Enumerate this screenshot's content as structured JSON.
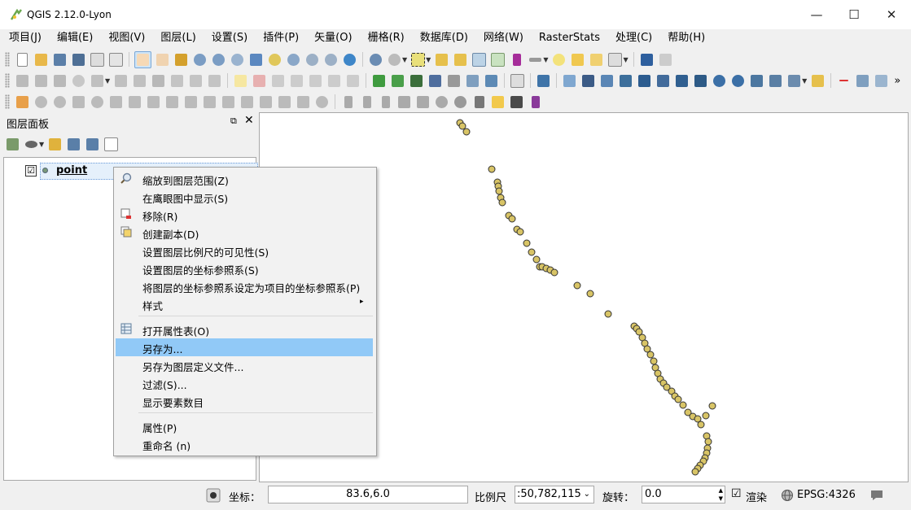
{
  "window": {
    "title": "QGIS 2.12.0-Lyon",
    "minimize": "—",
    "maximize": "☐",
    "close": "✕"
  },
  "menubar": [
    "项目(J)",
    "编辑(E)",
    "视图(V)",
    "图层(L)",
    "设置(S)",
    "插件(P)",
    "矢量(O)",
    "栅格(R)",
    "数据库(D)",
    "网络(W)",
    "RasterStats",
    "处理(C)",
    "帮助(H)"
  ],
  "toolbar_more": "»",
  "layers_panel": {
    "title": "图层面板",
    "float_icon": "⧉",
    "close_icon": "✕",
    "layer": {
      "name": "point",
      "checked": "☑"
    }
  },
  "context_menu": {
    "items": [
      {
        "label": "缩放到图层范围(Z)",
        "icon": "zoom-layer-icon"
      },
      {
        "label": "在鹰眼图中显示(S)",
        "icon": ""
      },
      {
        "label": "移除(R)",
        "icon": "remove-layer-icon"
      },
      {
        "label": "创建副本(D)",
        "icon": "duplicate-layer-icon"
      },
      {
        "label": "设置图层比例尺的可见性(S)",
        "icon": ""
      },
      {
        "label": "设置图层的坐标参照系(S)",
        "icon": ""
      },
      {
        "label": "将图层的坐标参照系设定为项目的坐标参照系(P)",
        "icon": ""
      },
      {
        "label": "样式",
        "icon": "",
        "submenu": "▸"
      },
      {
        "label": "打开属性表(O)",
        "icon": "attribute-table-icon"
      },
      {
        "label": "另存为...",
        "icon": "",
        "highlighted": true
      },
      {
        "label": "另存为图层定义文件...",
        "icon": ""
      },
      {
        "label": "过滤(S)...",
        "icon": ""
      },
      {
        "label": "显示要素数目",
        "icon": ""
      },
      {
        "label": "属性(P)",
        "icon": ""
      },
      {
        "label": "重命名 (n)",
        "icon": ""
      }
    ]
  },
  "statusbar": {
    "coord_label": "坐标：",
    "coord_value": "83.6,6.0",
    "scale_label": "比例尺",
    "scale_value": ":50,782,115",
    "rotation_label": "旋转：",
    "rotation_value": "0.0",
    "render_label": "渲染",
    "render_checked": "☑",
    "crs_label": "EPSG:4326",
    "message_icon": "speech-bubble-icon"
  },
  "colors": {
    "point_fill": "#d8c466",
    "point_stroke": "#333333",
    "highlight": "#91c9f7"
  }
}
